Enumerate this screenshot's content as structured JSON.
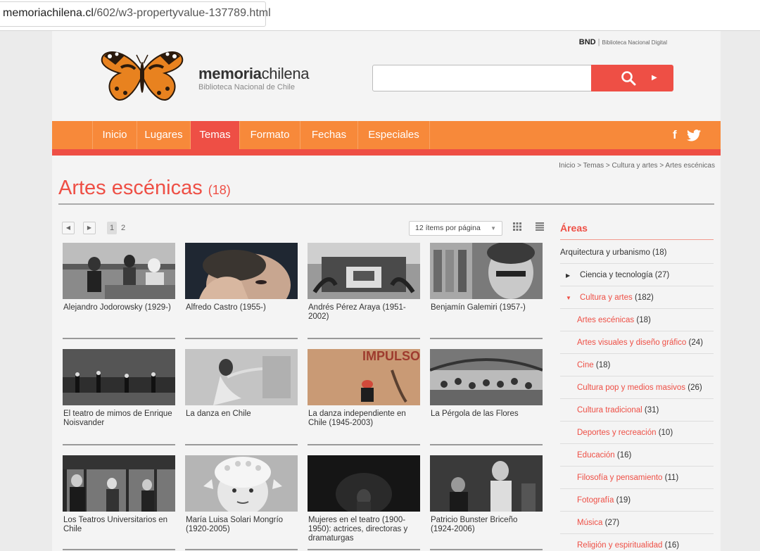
{
  "browser": {
    "url_host": "memoriachilena.cl",
    "url_path": "/602/w3-propertyvalue-137789.html"
  },
  "header": {
    "bnd_label": "BND",
    "bnd_sub": "Biblioteca Nacional Digital",
    "brand_bold": "memoria",
    "brand_rest": "chilena",
    "brand_sub": "Biblioteca Nacional de Chile",
    "search_placeholder": ""
  },
  "nav": {
    "items": [
      "Inicio",
      "Lugares",
      "Temas",
      "Formato",
      "Fechas",
      "Especiales"
    ],
    "active": "Temas",
    "social": [
      "f",
      "twitter"
    ]
  },
  "breadcrumb": "Inicio > Temas > Cultura y artes > Artes escénicas",
  "page_title": "Artes escénicas",
  "page_count": "(18)",
  "pagination": {
    "pages": [
      "1",
      "2"
    ],
    "current": "1"
  },
  "per_page": "12 ítems por página",
  "cards": [
    "Alejandro Jodorowsky (1929-)",
    "Alfredo Castro (1955-)",
    "Andrés Pérez Araya (1951-2002)",
    "Benjamín Galemiri (1957-)",
    "El teatro de mimos de Enrique Noisvander",
    "La danza en Chile",
    "La danza independiente en Chile (1945-2003)",
    "La Pérgola de las Flores",
    "Los Teatros Universitarios en Chile",
    "María Luisa Solari Mongrío (1920-2005)",
    "Mujeres en el teatro (1900-1950): actrices, directoras y dramaturgas",
    "Patricio Bunster Briceño (1924-2006)"
  ],
  "card_image_text": "IMPULSOS",
  "aside": {
    "title": "Áreas",
    "items": [
      {
        "label": "Arquitectura y urbanismo",
        "count": "(18)",
        "level": 0
      },
      {
        "label": "Ciencia y tecnología",
        "count": "(27)",
        "level": 1
      },
      {
        "label": "Cultura y artes",
        "count": "(182)",
        "level": 1
      },
      {
        "label": "Artes escénicas",
        "count": "(18)",
        "level": 2
      },
      {
        "label": "Artes visuales y diseño gráfico",
        "count": "(24)",
        "level": 2
      },
      {
        "label": "Cine",
        "count": "(18)",
        "level": 2
      },
      {
        "label": "Cultura pop y medios masivos",
        "count": "(26)",
        "level": 2
      },
      {
        "label": "Cultura tradicional",
        "count": "(31)",
        "level": 2
      },
      {
        "label": "Deportes y recreación",
        "count": "(10)",
        "level": 2
      },
      {
        "label": "Educación",
        "count": "(16)",
        "level": 2
      },
      {
        "label": "Filosofía y pensamiento",
        "count": "(11)",
        "level": 2
      },
      {
        "label": "Fotografía",
        "count": "(19)",
        "level": 2
      },
      {
        "label": "Música",
        "count": "(27)",
        "level": 2
      },
      {
        "label": "Religión y espiritualidad",
        "count": "(16)",
        "level": 2
      }
    ]
  },
  "colors": {
    "orange": "#f7893a",
    "red": "#ee4f45"
  }
}
